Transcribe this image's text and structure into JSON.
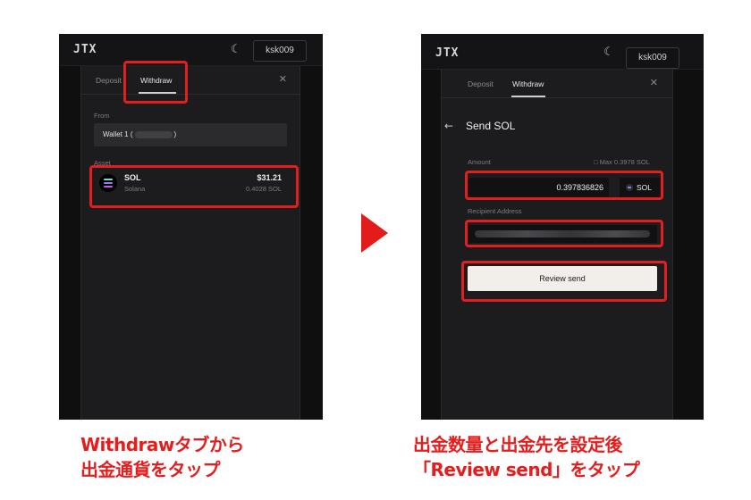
{
  "colors": {
    "highlight": "#e02020",
    "caption": "#e41e1e",
    "panel_bg": "#1c1c1e",
    "button_bg": "#f2efea"
  },
  "left_screen": {
    "logo": "JTX",
    "theme_icon": "moon-icon",
    "username": "ksk009",
    "tabs": [
      "Deposit",
      "Withdraw"
    ],
    "active_tab": "Withdraw",
    "close_icon": "close-icon",
    "from_label": "From",
    "wallet_prefix": "Wallet 1 (",
    "wallet_suffix": ")",
    "asset_label": "Asset",
    "asset": {
      "symbol": "SOL",
      "name": "Solana",
      "usd_value": "$31.21",
      "amount": "0.4028 SOL"
    }
  },
  "right_screen": {
    "logo": "JTX",
    "theme_icon": "moon-icon",
    "username": "ksk009",
    "tabs": [
      "Deposit",
      "Withdraw"
    ],
    "active_tab": "Withdraw",
    "close_icon": "close-icon",
    "back_icon": "back-arrow-icon",
    "title": "Send SOL",
    "amount_label": "Amount",
    "max_text": "Max 0.3978 SOL",
    "amount_value": "0.397836826",
    "amount_unit": "SOL",
    "recipient_label": "Recipient Address",
    "review_button": "Review send"
  },
  "step_arrow_icon": "triangle-right-icon",
  "captions": {
    "left_line1": "Withdrawタブから",
    "left_line2": "出金通貨をタップ",
    "right_line1": "出金数量と出金先を設定後",
    "right_line2": "「Review send」をタップ"
  }
}
